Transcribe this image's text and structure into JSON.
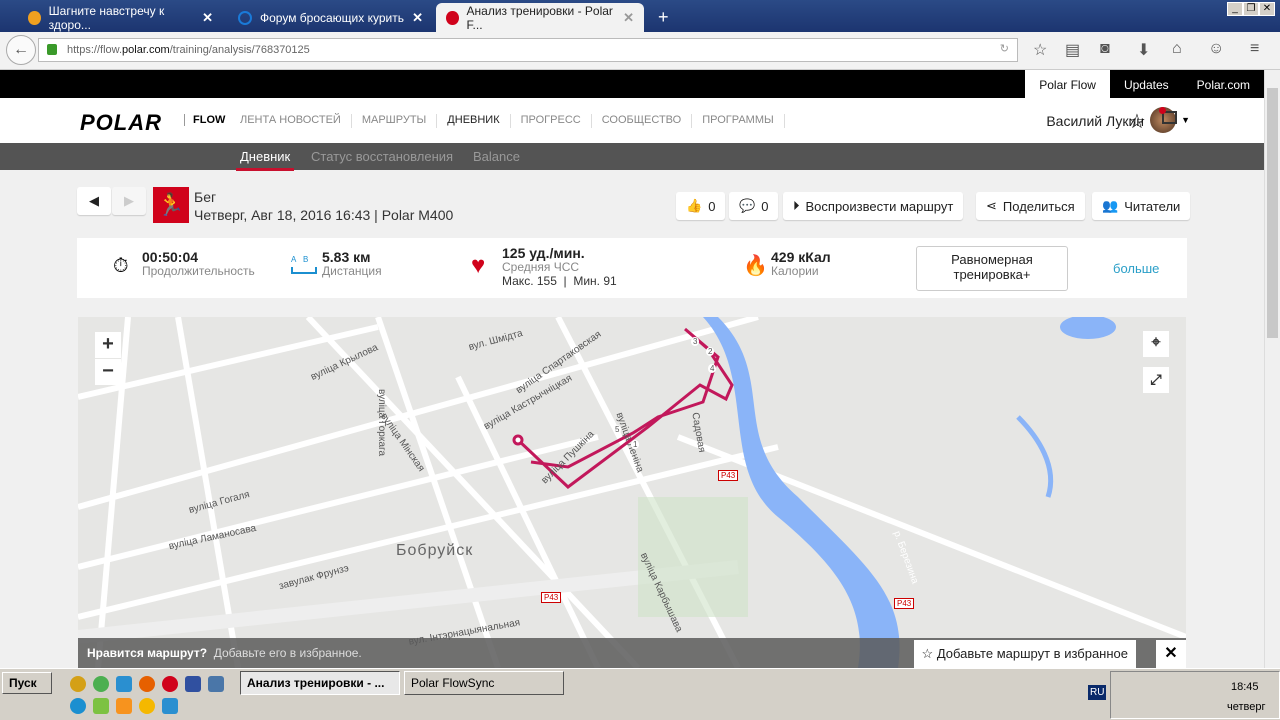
{
  "browser": {
    "tabs": [
      {
        "title": "Шагните навстречу к здоро...",
        "color": "#f0a020"
      },
      {
        "title": "Форум бросающих курить",
        "color": "#1a7ad8"
      },
      {
        "title": "Анализ тренировки - Polar F...",
        "color": "#d0021b"
      }
    ],
    "url_prefix": "https://flow.",
    "url_domain": "polar.com",
    "url_path": "/training/analysis/768370125"
  },
  "top_links": [
    "Polar Flow",
    "Updates",
    "Polar.com"
  ],
  "brand": {
    "logo": "POLAR",
    "product": "FLOW"
  },
  "main_menu": [
    "ЛЕНТА НОВОСТЕЙ",
    "МАРШРУТЫ",
    "ДНЕВНИК",
    "ПРОГРЕСС",
    "СООБЩЕСТВО",
    "ПРОГРАММЫ"
  ],
  "user": {
    "name": "Василий Лукин"
  },
  "sub_menu": [
    "Дневник",
    "Статус восстановления",
    "Balance"
  ],
  "session": {
    "sport": "Бег",
    "datetime": "Четверг, Авг 18, 2016 16:43 | Polar M400",
    "likes": "0",
    "comments": "0",
    "replay": "Воспроизвести маршрут",
    "share": "Поделиться",
    "followers": "Читатели"
  },
  "stats": {
    "duration": {
      "value": "00:50:04",
      "label": "Продолжительность"
    },
    "distance": {
      "value": "5.83 км",
      "label": "Дистанция",
      "a": "A",
      "b": "B"
    },
    "hr": {
      "value": "125 уд./мин.",
      "label": "Средняя ЧСС",
      "max": "Макс. 155",
      "min": "Мин. 91"
    },
    "calories": {
      "value": "429 кКал",
      "label": "Калории"
    },
    "benefit": "Равномерная тренировка+",
    "more": "больше"
  },
  "map": {
    "city": "Бобруйск",
    "river": "р. Березина",
    "road": "P43",
    "streets": [
      "вуліца Мінская",
      "вуліца Леніна",
      "вуліца Кастрычніцкая",
      "вул. Шмідта",
      "вуліца Крылова",
      "вуліца Гогаля",
      "вуліца Пушкіна",
      "вуліца Спартаковская",
      "вуліца Горкага",
      "завулак Фрунзэ",
      "вуліца Карбышава",
      "вул. Інтэрнацыянальная",
      "вуліца Ламаносава",
      "Садовая"
    ],
    "markers": [
      "1",
      "2",
      "3",
      "4",
      "5"
    ],
    "banner_title": "Нравится маршрут?",
    "banner_text": "Добавьте его в избранное.",
    "fav_button": "Добавьте маршрут в избранное"
  },
  "taskbar": {
    "start": "Пуск",
    "tasks": [
      "Анализ тренировки - ...",
      "Polar FlowSync"
    ],
    "lang": "RU",
    "time": "18:45",
    "day": "четверг"
  }
}
